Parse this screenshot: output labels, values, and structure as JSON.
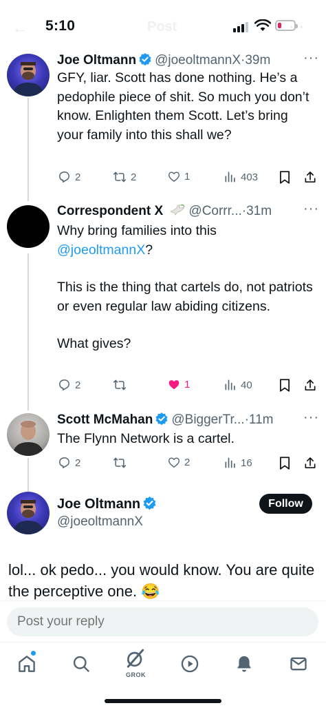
{
  "status_bar": {
    "time": "5:10",
    "ghost_title": "Post"
  },
  "tweets": [
    {
      "name": "Joe Oltmann",
      "handle": "@joeoltmannX",
      "time": "·39m",
      "text": "GFY, liar. Scott has done nothing. He’s a pedophile piece of shit. So much you don’t know. Enlighten them Scott. Let’s bring your family into this shall we?",
      "replies": "2",
      "reposts": "2",
      "likes": "1",
      "views": "403"
    },
    {
      "name": "Correspondent X",
      "handle": "@Corrr...",
      "time": "·31m",
      "text_prefix": "Why bring families into this ",
      "mention": "@joeoltmannX",
      "text_suffix": "?",
      "text_p2": "This is the thing that cartels do, not patriots or even regular law abiding citizens.",
      "text_p3": "What gives?",
      "replies": "2",
      "reposts": "",
      "likes": "1",
      "views": "40",
      "liked": true
    },
    {
      "name": "Scott McMahan",
      "handle": "@BiggerTr...",
      "time": "·11m",
      "text": "The Flynn Network is a cartel.",
      "replies": "2",
      "reposts": "",
      "likes": "2",
      "views": "16"
    }
  ],
  "main_tweet": {
    "name": "Joe Oltmann",
    "handle": "@joeoltmannX",
    "follow_label": "Follow",
    "text": "lol... ok pedo... you would know. You are quite the perceptive one. 😂"
  },
  "reply": {
    "placeholder": "Post your reply"
  },
  "tabbar": {
    "grok_label": "GROK"
  },
  "colors": {
    "accent": "#1d9bf0",
    "like": "#f91880",
    "text": "#0f1419",
    "muted": "#536471"
  },
  "icons": [
    "reply-icon",
    "repost-icon",
    "like-icon",
    "views-icon",
    "bookmark-icon",
    "share-icon",
    "home-icon",
    "search-icon",
    "grok-icon",
    "video-icon",
    "notifications-icon",
    "messages-icon"
  ]
}
